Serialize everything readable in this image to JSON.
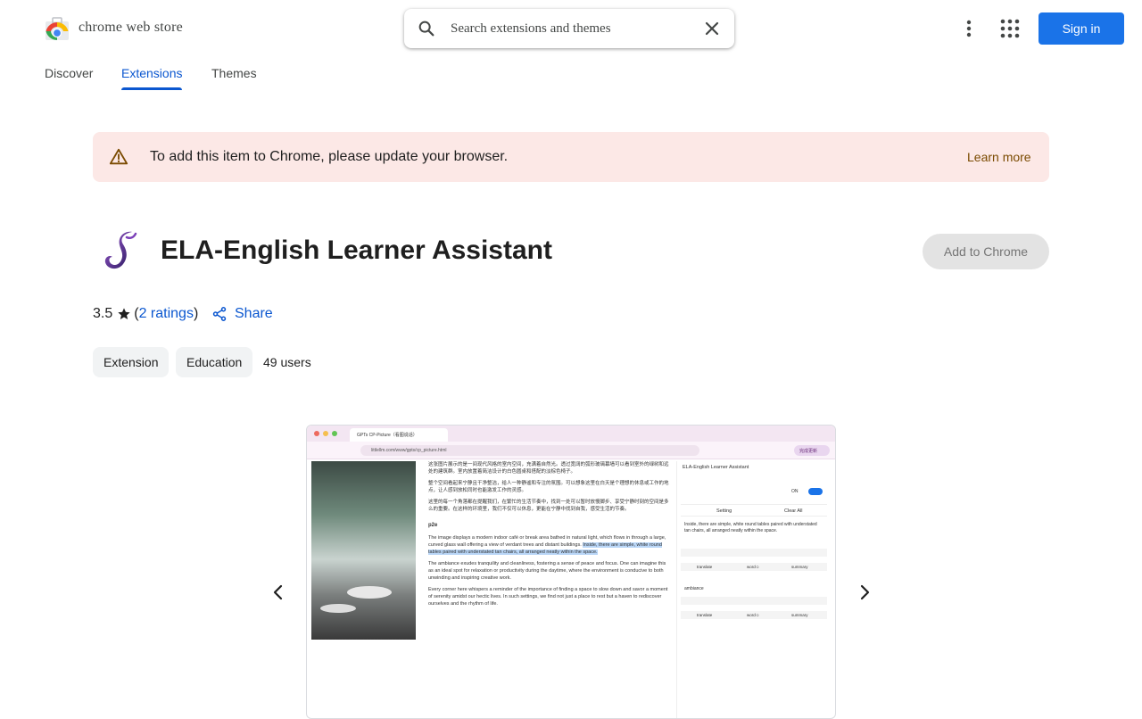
{
  "header": {
    "brand": "chrome web store",
    "search_placeholder": "Search extensions and themes",
    "sign_in_label": "Sign in"
  },
  "nav": {
    "tabs": [
      {
        "label": "Discover",
        "active": false
      },
      {
        "label": "Extensions",
        "active": true
      },
      {
        "label": "Themes",
        "active": false
      }
    ]
  },
  "banner": {
    "message": "To add this item to Chrome, please update your browser.",
    "link_label": "Learn more",
    "background": "#fce8e6"
  },
  "extension": {
    "name": "ELA-English Learner Assistant",
    "add_label": "Add to Chrome",
    "rating": "3.5",
    "ratings_open": "(",
    "ratings_link": "2 ratings",
    "ratings_close": ")",
    "share_label": "Share",
    "chips": [
      "Extension",
      "Education"
    ],
    "users": "49 users"
  },
  "screenshot": {
    "tab_title": "GPTs CP-Picture（看图说话）",
    "url": "littlellm.com/www/gpts/cp_picture.html",
    "update_label": "完成更新",
    "article": {
      "zh1": "这张图片展示的是一间现代风格的室内空间，充满着自然光。透过宽阔的弧形玻璃幕墙可以看到室外的绿树和远处的建筑群。室内放置着简洁设计的白色圆桌和搭配的淡棕色椅子。",
      "zh2": "整个空间看起来宁静且干净整洁，给人一种静谧和专注的氛围。可以想象这里在白天是个理想的休息或工作的地点，让人感到放松同时也能激发工作的灵感。",
      "zh3": "这里的每一个角落都在提醒我们，在繁忙的生活节奏中，找到一处可以暂时放慢脚步、享受宁静时刻的空间是多么的重要。在这样的环境里，我们不仅可以休息，更能在宁静中找到自我，感受生活的节奏。",
      "heading": "p2e",
      "en1": "The image displays a modern indoor café or break area bathed in natural light, which flows in through a large, curved glass wall offering a view of verdant trees and distant buildings.",
      "en1_highlight": "Inside, there are simple, white round tables paired with understated tan chairs, all arranged neatly within the space.",
      "en2": "The ambiance exudes tranquility and cleanliness, fostering a sense of peace and focus. One can imagine this as an ideal spot for relaxation or productivity during the daytime, where the environment is conducive to both unwinding and inspiring creative work.",
      "en3": "Every corner here whispers a reminder of the importance of finding a space to slow down and savor a moment of serenity amidst our hectic lives. In such settings, we find not just a place to rest but a haven to rediscover ourselves and the rhythm of life."
    },
    "panel": {
      "title": "ELA-English Learner Assistant",
      "on_label": "ON",
      "setting_label": "Setting",
      "clear_label": "Clear All",
      "card1_text": "Inside, there are simple, white round tables paired with understated tan chairs, all arranged neatly within the space.",
      "card2_text": "ambiance",
      "actions": [
        "translate",
        "word☺",
        "summary"
      ]
    }
  },
  "colors": {
    "accent": "#0b57d0",
    "primary_button": "#1a73e8",
    "disabled_button": "#e3e3e3"
  }
}
